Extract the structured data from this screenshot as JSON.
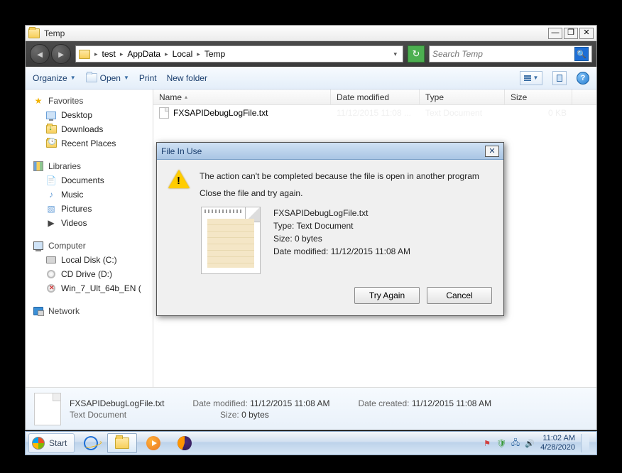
{
  "window": {
    "title": "Temp"
  },
  "address": {
    "crumbs": [
      "test",
      "AppData",
      "Local",
      "Temp"
    ]
  },
  "search": {
    "placeholder": "Search Temp"
  },
  "toolbar": {
    "organize": "Organize",
    "open": "Open",
    "print": "Print",
    "newfolder": "New folder"
  },
  "sidebar": {
    "favorites": {
      "label": "Favorites",
      "items": [
        "Desktop",
        "Downloads",
        "Recent Places"
      ]
    },
    "libraries": {
      "label": "Libraries",
      "items": [
        "Documents",
        "Music",
        "Pictures",
        "Videos"
      ]
    },
    "computer": {
      "label": "Computer",
      "items": [
        "Local Disk (C:)",
        "CD Drive (D:)",
        "Win_7_Ult_64b_EN ("
      ]
    },
    "network": {
      "label": "Network"
    }
  },
  "columns": {
    "name": "Name",
    "date": "Date modified",
    "type": "Type",
    "size": "Size"
  },
  "files": [
    {
      "name": "FXSAPIDebugLogFile.txt",
      "date": "11/12/2015 11:08 ...",
      "type": "Text Document",
      "size": "0 KB"
    }
  ],
  "details": {
    "name": "FXSAPIDebugLogFile.txt",
    "subtype": "Text Document",
    "modified_label": "Date modified:",
    "modified": "11/12/2015 11:08 AM",
    "size_label": "Size:",
    "size": "0 bytes",
    "created_label": "Date created:",
    "created": "11/12/2015 11:08 AM"
  },
  "dialog": {
    "title": "File In Use",
    "line1": "The action can't be completed because the file is open in another program",
    "line2": "Close the file and try again.",
    "file": {
      "name": "FXSAPIDebugLogFile.txt",
      "type_label": "Type:",
      "type": "Text Document",
      "size_label": "Size:",
      "size": "0 bytes",
      "modified_label": "Date modified:",
      "modified": "11/12/2015 11:08 AM"
    },
    "try_again": "Try Again",
    "cancel": "Cancel"
  },
  "taskbar": {
    "start": "Start",
    "time": "11:02 AM",
    "date": "4/28/2020"
  }
}
